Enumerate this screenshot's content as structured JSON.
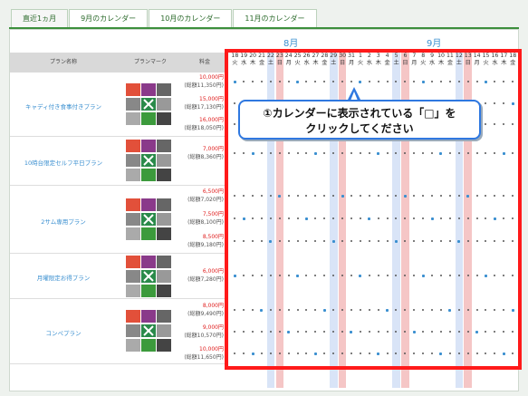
{
  "tabs": [
    "直近1ヵ月",
    "9月のカレンダー",
    "10月のカレンダー",
    "11月のカレンダー"
  ],
  "headers": {
    "plan": "プラン名称",
    "mark": "プランマーク",
    "price": "料金"
  },
  "months": [
    "8月",
    "9月"
  ],
  "days": [
    "18",
    "19",
    "20",
    "21",
    "22",
    "23",
    "24",
    "25",
    "26",
    "27",
    "28",
    "29",
    "30",
    "31",
    "1",
    "2",
    "3",
    "4",
    "5",
    "6",
    "7",
    "8",
    "9",
    "10",
    "11",
    "12",
    "13",
    "14",
    "15",
    "16",
    "17",
    "18"
  ],
  "weekdays": [
    "火",
    "水",
    "木",
    "金",
    "土",
    "日",
    "月",
    "火",
    "水",
    "木",
    "金",
    "土",
    "日",
    "月",
    "火",
    "水",
    "木",
    "金",
    "土",
    "日",
    "月",
    "火",
    "水",
    "木",
    "金",
    "土",
    "日",
    "月",
    "火",
    "水",
    "木",
    "金"
  ],
  "plans": [
    {
      "name": "キャディ付き食事付きプラン",
      "rows": [
        {
          "price": "10,000円",
          "total": "(総額11,350円)"
        },
        {
          "price": "15,000円",
          "total": "(総額17,130円)"
        },
        {
          "price": "16,000円",
          "total": "(総額18,050円)"
        }
      ]
    },
    {
      "name": "10時台限定セルフ平日プラン",
      "rows": [
        {
          "price": "7,000円",
          "total": "(総額8,360円)"
        }
      ]
    },
    {
      "name": "2サム専用プラン",
      "rows": [
        {
          "price": "6,500円",
          "total": "(総額7,020円)"
        },
        {
          "price": "7,500円",
          "total": "(総額8,100円)"
        },
        {
          "price": "8,500円",
          "total": "(総額9,180円)"
        }
      ]
    },
    {
      "name": "月曜限定お得プラン",
      "rows": [
        {
          "price": "6,000円",
          "total": "(総額7,280円)"
        }
      ]
    },
    {
      "name": "コンペプラン",
      "rows": [
        {
          "price": "8,000円",
          "total": "(総額9,490円)"
        },
        {
          "price": "9,000円",
          "total": "(総額10,570円)"
        },
        {
          "price": "10,000円",
          "total": "(総額11,650円)"
        }
      ]
    }
  ],
  "tooltip": {
    "line1": "①カレンダーに表示されている「□」を",
    "line2": "クリックしてください"
  },
  "colors": {
    "highlight": "#ff1a1a",
    "callout": "#2f78e0"
  }
}
